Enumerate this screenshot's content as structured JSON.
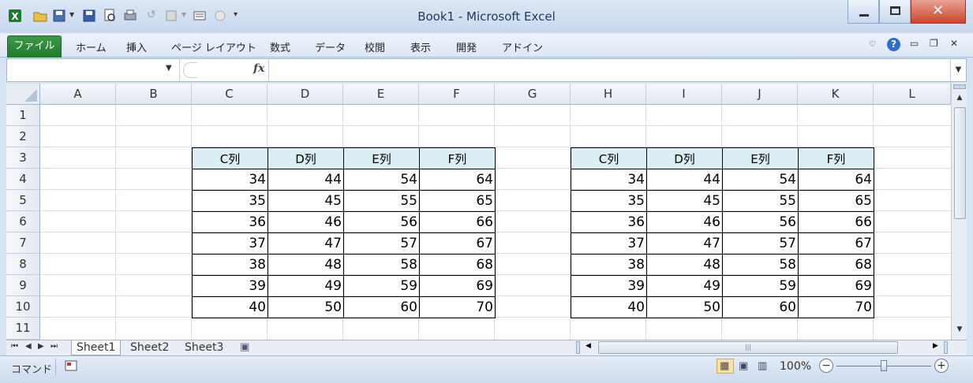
{
  "window": {
    "title": "Book1  -  Microsoft Excel"
  },
  "ribbon": {
    "file_tab": "ファイル",
    "tabs": [
      "ホーム",
      "挿入",
      "ページ レイアウト",
      "数式",
      "データ",
      "校閲",
      "表示",
      "開発",
      "アドイン"
    ]
  },
  "formula_bar": {
    "name_box_value": "",
    "fx_label": "fx",
    "formula_value": ""
  },
  "grid": {
    "columns": [
      "A",
      "B",
      "C",
      "D",
      "E",
      "F",
      "G",
      "H",
      "I",
      "J",
      "K",
      "L"
    ],
    "rows": [
      "1",
      "2",
      "3",
      "4",
      "5",
      "6",
      "7",
      "8",
      "9",
      "10",
      "11"
    ]
  },
  "table_left": {
    "headers": [
      "C列",
      "D列",
      "E列",
      "F列"
    ],
    "rows": [
      [
        "34",
        "44",
        "54",
        "64"
      ],
      [
        "35",
        "45",
        "55",
        "65"
      ],
      [
        "36",
        "46",
        "56",
        "66"
      ],
      [
        "37",
        "47",
        "57",
        "67"
      ],
      [
        "38",
        "48",
        "58",
        "68"
      ],
      [
        "39",
        "49",
        "59",
        "69"
      ],
      [
        "40",
        "50",
        "60",
        "70"
      ]
    ]
  },
  "table_right": {
    "headers": [
      "C列",
      "D列",
      "E列",
      "F列"
    ],
    "rows": [
      [
        "34",
        "44",
        "54",
        "64"
      ],
      [
        "35",
        "45",
        "55",
        "65"
      ],
      [
        "36",
        "46",
        "56",
        "66"
      ],
      [
        "37",
        "47",
        "57",
        "67"
      ],
      [
        "38",
        "48",
        "58",
        "68"
      ],
      [
        "39",
        "49",
        "59",
        "69"
      ],
      [
        "40",
        "50",
        "60",
        "70"
      ]
    ]
  },
  "sheets": {
    "tabs": [
      "Sheet1",
      "Sheet2",
      "Sheet3"
    ],
    "active": "Sheet1"
  },
  "status": {
    "mode": "コマンド",
    "zoom": "100%"
  },
  "colors": {
    "file_tab": "#1e7a2c",
    "table_header_fill": "#daeef3",
    "selected_view": "#fbe3a8"
  }
}
